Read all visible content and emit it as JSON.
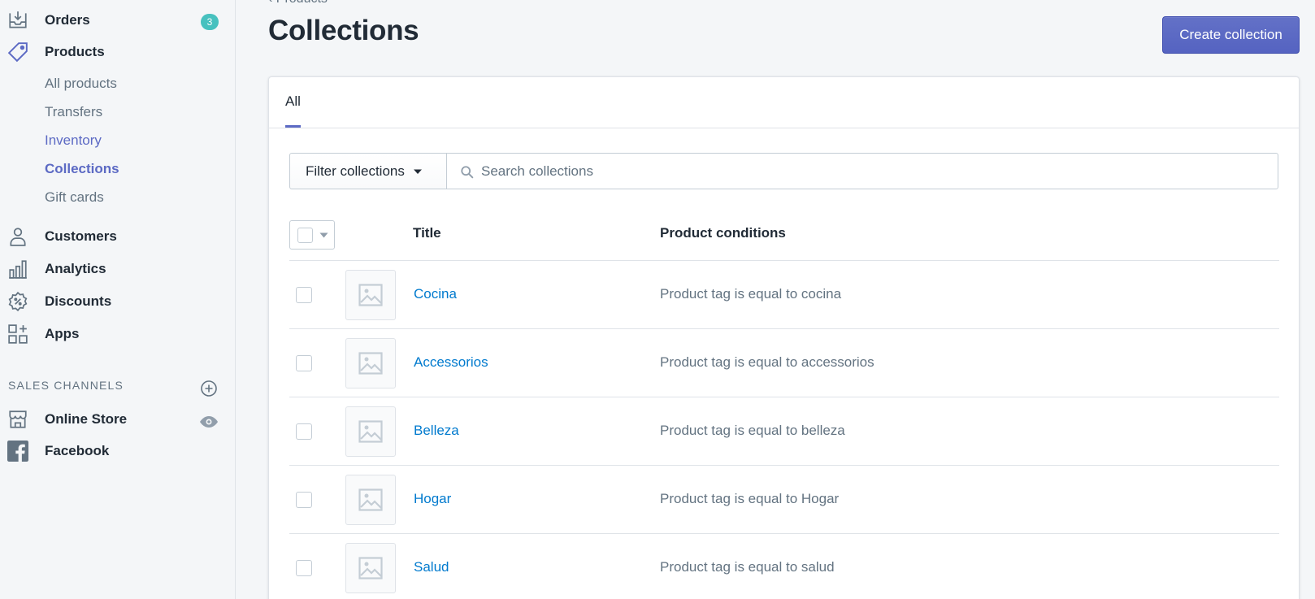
{
  "sidebar": {
    "orders": {
      "label": "Orders",
      "badge": "3"
    },
    "products": {
      "label": "Products",
      "sub_items": [
        "All products",
        "Transfers",
        "Inventory",
        "Collections",
        "Gift cards"
      ]
    },
    "customers": "Customers",
    "analytics": "Analytics",
    "discounts": "Discounts",
    "apps": "Apps",
    "sales_channels_label": "SALES CHANNELS",
    "online_store": "Online Store",
    "facebook": "Facebook"
  },
  "header": {
    "breadcrumb": "‹ Products",
    "title": "Collections",
    "create_button": "Create collection"
  },
  "tabs": [
    "All"
  ],
  "filter": {
    "label": "Filter collections",
    "search_placeholder": "Search collections"
  },
  "table": {
    "columns": [
      "Title",
      "Product conditions"
    ],
    "rows": [
      {
        "title": "Cocina",
        "condition": "Product tag is equal to cocina"
      },
      {
        "title": "Accessorios",
        "condition": "Product tag is equal to accessorios"
      },
      {
        "title": "Belleza",
        "condition": "Product tag is equal to belleza"
      },
      {
        "title": "Hogar",
        "condition": "Product tag is equal to Hogar"
      },
      {
        "title": "Salud",
        "condition": "Product tag is equal to salud"
      }
    ]
  },
  "colors": {
    "accent": "#5c6ac4",
    "link": "#007ace",
    "badge": "#47c1bf"
  }
}
